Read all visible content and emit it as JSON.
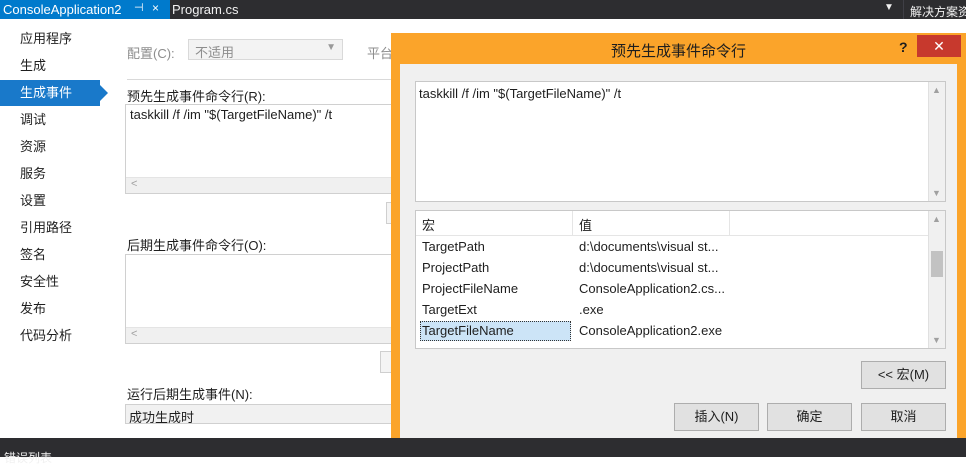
{
  "tabs": {
    "active_tab": "ConsoleApplication2",
    "pin_glyph": "⊣",
    "close_glyph": "×",
    "second_tab": "Program.cs",
    "dropdown_glyph": "▼",
    "solution_explorer": "解决方案资"
  },
  "bottom_bar": {
    "label": "错误列表"
  },
  "nav": {
    "items": [
      {
        "label": "应用程序"
      },
      {
        "label": "生成"
      },
      {
        "label": "生成事件",
        "active": true
      },
      {
        "label": "调试"
      },
      {
        "label": "资源"
      },
      {
        "label": "服务"
      },
      {
        "label": "设置"
      },
      {
        "label": "引用路径"
      },
      {
        "label": "签名"
      },
      {
        "label": "安全性"
      },
      {
        "label": "发布"
      },
      {
        "label": "代码分析"
      }
    ]
  },
  "page": {
    "config_label": "配置(C):",
    "config_value": "不适用",
    "platform_label": "平台",
    "prebuild_label": "预先生成事件命令行(R):",
    "prebuild_value": "taskkill /f /im \"$(TargetFileName)\" /t",
    "postbuild_label": "后期生成事件命令行(O):",
    "postbuild_value": "",
    "run_post_label": "运行后期生成事件(N):",
    "run_post_value": "成功生成时"
  },
  "dialog": {
    "title": "预先生成事件命令行",
    "help": "?",
    "close": "✕",
    "command_text": "taskkill /f /im \"$(TargetFileName)\" /t",
    "columns": {
      "macro": "宏",
      "value": "值"
    },
    "rows": [
      {
        "macro": "TargetPath",
        "value": "d:\\documents\\visual st..."
      },
      {
        "macro": "ProjectPath",
        "value": "d:\\documents\\visual st..."
      },
      {
        "macro": "ProjectFileName",
        "value": "ConsoleApplication2.cs..."
      },
      {
        "macro": "TargetExt",
        "value": ".exe"
      },
      {
        "macro": "TargetFileName",
        "value": "ConsoleApplication2.exe",
        "selected": true
      }
    ],
    "macros_button": "<< 宏(M)",
    "insert_button": "插入(N)",
    "ok_button": "确定",
    "cancel_button": "取消"
  },
  "colors": {
    "accent": "#007acc",
    "dialog_frame": "#fba42a",
    "nav_active": "#1979ca",
    "close_red": "#c7392d"
  }
}
